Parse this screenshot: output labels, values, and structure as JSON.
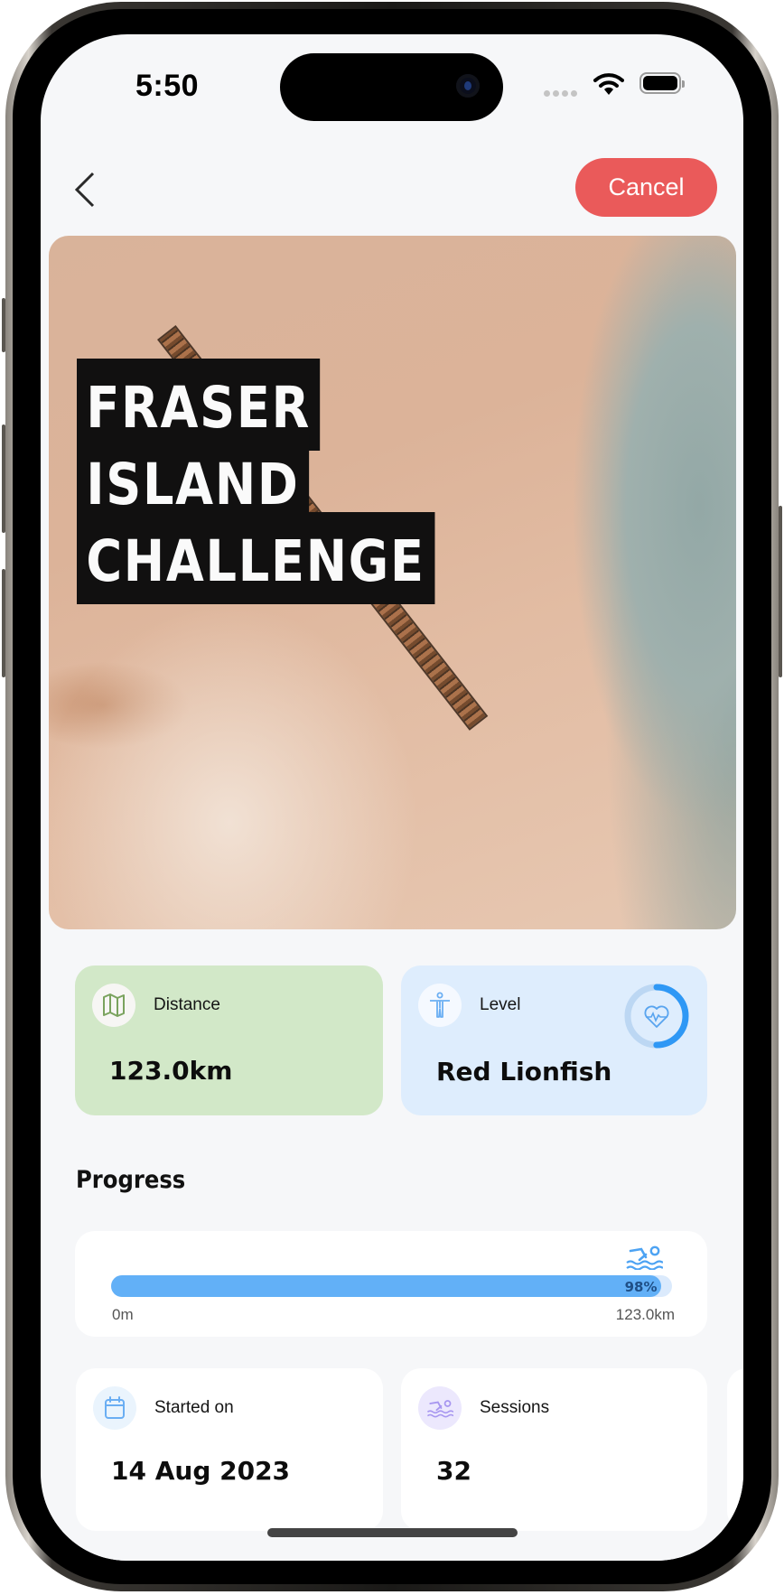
{
  "status_bar": {
    "time": "5:50",
    "wifi_icon": "wifi-icon",
    "battery_icon": "battery-icon"
  },
  "header": {
    "back_icon": "chevron-left-icon",
    "cancel_label": "Cancel",
    "cancel_color": "#ea5a5a"
  },
  "hero": {
    "title_lines": [
      "FRASER",
      "ISLAND",
      "CHALLENGE"
    ]
  },
  "stats": {
    "distance": {
      "icon": "map-icon",
      "label": "Distance",
      "value": "123.0km",
      "color": "#d2e8c8"
    },
    "level": {
      "icon": "accessibility-icon",
      "label": "Level",
      "value": "Red Lionfish",
      "color": "#deedfd",
      "ring_icon": "heart-pulse-icon",
      "ring_progress": 0.5
    }
  },
  "progress": {
    "title": "Progress",
    "percent": 98,
    "percent_label": "98%",
    "start_label": "0m",
    "end_label": "123.0km",
    "marker_icon": "swimmer-icon"
  },
  "info_cards": [
    {
      "icon": "calendar-icon",
      "label": "Started on",
      "value": "14 Aug 2023"
    },
    {
      "icon": "swimmer-icon",
      "label": "Sessions",
      "value": "32"
    }
  ]
}
